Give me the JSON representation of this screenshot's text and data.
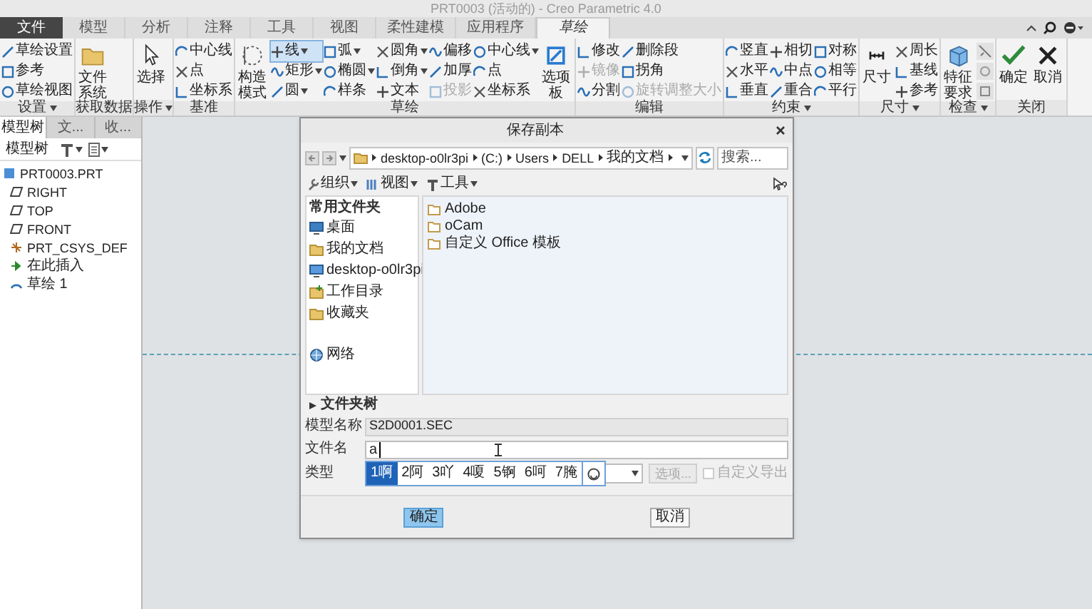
{
  "window": {
    "title": "PRT0003 (活动的) - Creo Parametric 4.0"
  },
  "ribbon": {
    "tabs": [
      {
        "label": "文件",
        "kind": "file",
        "selected": false
      },
      {
        "label": "模型",
        "kind": "tab",
        "selected": false
      },
      {
        "label": "分析",
        "kind": "tab",
        "selected": false
      },
      {
        "label": "注释",
        "kind": "tab",
        "selected": false
      },
      {
        "label": "工具",
        "kind": "tab",
        "selected": false
      },
      {
        "label": "视图",
        "kind": "tab",
        "selected": false
      },
      {
        "label": "柔性建模",
        "kind": "tab",
        "selected": false
      },
      {
        "label": "应用程序",
        "kind": "tab",
        "selected": false
      },
      {
        "label": "草绘",
        "kind": "tab",
        "selected": true
      }
    ],
    "groups": [
      {
        "label": "设置",
        "menu": true,
        "columns": [
          {
            "kind": "stack",
            "items": [
              {
                "label": "草绘设置"
              },
              {
                "label": "参考"
              },
              {
                "label": "草绘视图"
              }
            ]
          }
        ]
      },
      {
        "label": "获取数据",
        "menu": false,
        "columns": [
          {
            "kind": "large",
            "label": "文件系统"
          }
        ]
      },
      {
        "label": "操作",
        "menu": true,
        "columns": [
          {
            "kind": "large",
            "label": "选择"
          }
        ]
      },
      {
        "label": "基准",
        "menu": false,
        "columns": [
          {
            "kind": "stack",
            "items": [
              {
                "label": "中心线"
              },
              {
                "label": "点"
              },
              {
                "label": "坐标系"
              }
            ]
          }
        ]
      },
      {
        "label": "草绘",
        "menu": false,
        "columns": [
          {
            "kind": "large",
            "label": "构造模式"
          },
          {
            "kind": "stack",
            "items": [
              {
                "label": "线",
                "menu": true,
                "selected": true
              },
              {
                "label": "矩形",
                "menu": true,
                "selected": false
              },
              {
                "label": "圆",
                "menu": true,
                "selected": false
              }
            ]
          },
          {
            "kind": "stack",
            "items": [
              {
                "label": "弧",
                "menu": true
              },
              {
                "label": "椭圆",
                "menu": true
              },
              {
                "label": "样条"
              }
            ]
          },
          {
            "kind": "stack",
            "items": [
              {
                "label": "圆角",
                "menu": true
              },
              {
                "label": "倒角",
                "menu": true
              },
              {
                "label": "文本"
              }
            ]
          },
          {
            "kind": "stack",
            "items": [
              {
                "label": "偏移",
                "disabled": false
              },
              {
                "label": "加厚",
                "disabled": false
              },
              {
                "label": "投影",
                "disabled": true
              }
            ]
          },
          {
            "kind": "stack",
            "items": [
              {
                "label": "中心线",
                "menu": true
              },
              {
                "label": "点"
              },
              {
                "label": "坐标系"
              }
            ]
          },
          {
            "kind": "large",
            "label": "选项板"
          }
        ]
      },
      {
        "label": "编辑",
        "menu": false,
        "columns": [
          {
            "kind": "stack",
            "items": [
              {
                "label": "修改",
                "disabled": false
              },
              {
                "label": "镜像",
                "disabled": true
              },
              {
                "label": "分割",
                "disabled": false
              }
            ]
          },
          {
            "kind": "stack",
            "items": [
              {
                "label": "删除段",
                "disabled": false
              },
              {
                "label": "拐角",
                "disabled": false
              },
              {
                "label": "旋转调整大小",
                "disabled": true
              }
            ]
          }
        ]
      },
      {
        "label": "约束",
        "menu": true,
        "columns": [
          {
            "kind": "stack",
            "items": [
              {
                "label": "竖直"
              },
              {
                "label": "水平"
              },
              {
                "label": "垂直"
              }
            ]
          },
          {
            "kind": "stack",
            "items": [
              {
                "label": "相切"
              },
              {
                "label": "中点"
              },
              {
                "label": "重合"
              }
            ]
          },
          {
            "kind": "stack",
            "items": [
              {
                "label": "对称"
              },
              {
                "label": "相等"
              },
              {
                "label": "平行"
              }
            ]
          }
        ]
      },
      {
        "label": "尺寸",
        "menu": true,
        "columns": [
          {
            "kind": "large",
            "label": "尺寸"
          },
          {
            "kind": "stack",
            "items": [
              {
                "label": "周长"
              },
              {
                "label": "基线"
              },
              {
                "label": "参考"
              }
            ]
          }
        ]
      },
      {
        "label": "检查",
        "menu": true,
        "columns": [
          {
            "kind": "large",
            "label": "特征要求"
          },
          {
            "kind": "icon_stack"
          }
        ]
      },
      {
        "label": "关闭",
        "menu": false,
        "columns": [
          {
            "kind": "large",
            "label": "确定"
          },
          {
            "kind": "large",
            "label": "取消"
          }
        ]
      }
    ]
  },
  "model_tree": {
    "tabs": [
      {
        "label": "模型树",
        "selected": true
      },
      {
        "label": "文...",
        "selected": false
      },
      {
        "label": "收...",
        "selected": false
      }
    ],
    "toolbar_label": "模型树",
    "root": {
      "label": "PRT0003.PRT",
      "kind": "part",
      "children": [
        {
          "label": "RIGHT",
          "kind": "plane"
        },
        {
          "label": "TOP",
          "kind": "plane"
        },
        {
          "label": "FRONT",
          "kind": "plane"
        },
        {
          "label": "PRT_CSYS_DEF",
          "kind": "csys"
        },
        {
          "label": "在此插入",
          "kind": "insert"
        },
        {
          "label": "草绘 1",
          "kind": "sketch"
        }
      ]
    }
  },
  "dialog": {
    "title": "保存副本",
    "path": [
      "desktop-o0lr3pi",
      "(C:)",
      "Users",
      "DELL",
      "我的文档"
    ],
    "search": {
      "placeholder": "搜索..."
    },
    "toolbar": [
      {
        "label": "组织"
      },
      {
        "label": "视图"
      },
      {
        "label": "工具"
      }
    ],
    "sidebar": {
      "heading": "常用文件夹",
      "items": [
        {
          "label": "桌面",
          "kind": "desktop"
        },
        {
          "label": "我的文档",
          "kind": "documents"
        },
        {
          "label": "desktop-o0lr3pi",
          "kind": "computer"
        },
        {
          "label": "工作目录",
          "kind": "workdir"
        },
        {
          "label": "收藏夹",
          "kind": "favorites"
        },
        {
          "label": "网络",
          "kind": "network"
        }
      ]
    },
    "files": [
      {
        "label": "Adobe"
      },
      {
        "label": "oCam"
      },
      {
        "label": "自定义 Office 模板"
      }
    ],
    "folder_tree": {
      "label": "文件夹树",
      "expanded": false
    },
    "model_name": {
      "label": "模型名称",
      "value": "S2D0001.SEC"
    },
    "file_name": {
      "label": "文件名",
      "value": "a"
    },
    "type": {
      "label": "类型"
    },
    "options_button": {
      "label": "选项...",
      "disabled": true
    },
    "custom_export": {
      "label": "自定义导出",
      "checked": false,
      "disabled": true
    },
    "ime": {
      "candidates": [
        {
          "number": "1",
          "text": "啊",
          "selected": true
        },
        {
          "number": "2",
          "text": "阿",
          "selected": false
        },
        {
          "number": "3",
          "text": "吖",
          "selected": false
        },
        {
          "number": "4",
          "text": "嗄",
          "selected": false
        },
        {
          "number": "5",
          "text": "锕",
          "selected": false
        },
        {
          "number": "6",
          "text": "呵",
          "selected": false
        },
        {
          "number": "7",
          "text": "腌",
          "selected": false
        }
      ]
    },
    "buttons": [
      {
        "label": "确定",
        "default": true
      },
      {
        "label": "取消",
        "default": false
      }
    ]
  }
}
